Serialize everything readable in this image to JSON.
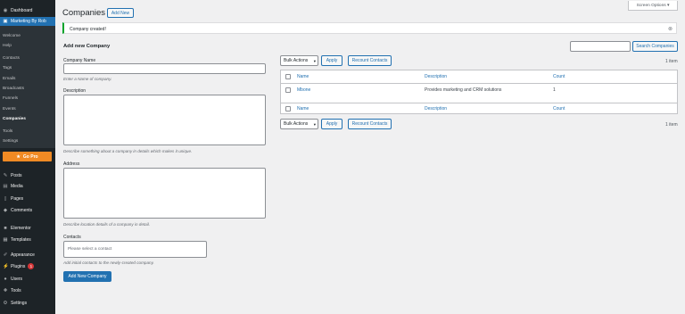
{
  "sidebar": {
    "dashboard": "Dashboard",
    "marketing": "Marketing By Rob",
    "submenu": [
      "Welcome",
      "Help",
      "Contacts",
      "Tags",
      "Emails",
      "Broadcasts",
      "Funnels",
      "Events",
      "Companies",
      "Tools",
      "Settings"
    ],
    "go_pro": "Go Pro",
    "menu": [
      {
        "label": "Posts",
        "icon": "pin-icon"
      },
      {
        "label": "Media",
        "icon": "media-icon"
      },
      {
        "label": "Pages",
        "icon": "pages-icon"
      },
      {
        "label": "Comments",
        "icon": "comments-icon"
      },
      {
        "label": "Elementor",
        "icon": "elementor-icon"
      },
      {
        "label": "Templates",
        "icon": "templates-icon"
      },
      {
        "label": "Appearance",
        "icon": "appearance-icon"
      },
      {
        "label": "Plugins",
        "icon": "plugins-icon",
        "badge": "1"
      },
      {
        "label": "Users",
        "icon": "users-icon"
      },
      {
        "label": "Tools",
        "icon": "tools-icon"
      },
      {
        "label": "Settings",
        "icon": "settings-icon"
      }
    ]
  },
  "header": {
    "title": "Companies",
    "add_new": "Add New",
    "screen_options": "Screen Options ▾"
  },
  "notice": {
    "text": "Company created!"
  },
  "form": {
    "heading": "Add new Company",
    "name_label": "Company Name",
    "name_hint": "Enter a Name of company.",
    "desc_label": "Description",
    "desc_hint": "Describe something about a company in details which makes it unique.",
    "address_label": "Address",
    "address_hint": "Describe location details of a company in detail.",
    "contacts_label": "Contacts",
    "contacts_placeholder": "Please select a contact",
    "contacts_hint": "Add initial contacts to the newly-created company.",
    "submit": "Add New Company"
  },
  "table": {
    "search_button": "Search Companies",
    "bulk_actions": "Bulk Actions",
    "apply": "Apply",
    "recount": "Recount Contacts",
    "count_text": "1 item",
    "columns": [
      "Name",
      "Description",
      "Count"
    ],
    "rows": [
      {
        "name": "Mbone",
        "description": "Provides marketing and CRM solutions",
        "count": "1"
      }
    ]
  },
  "colors": {
    "accent": "#2271b1",
    "sidebar": "#1d2327",
    "go_pro": "#f08a24",
    "notice_border": "#00a32a"
  }
}
